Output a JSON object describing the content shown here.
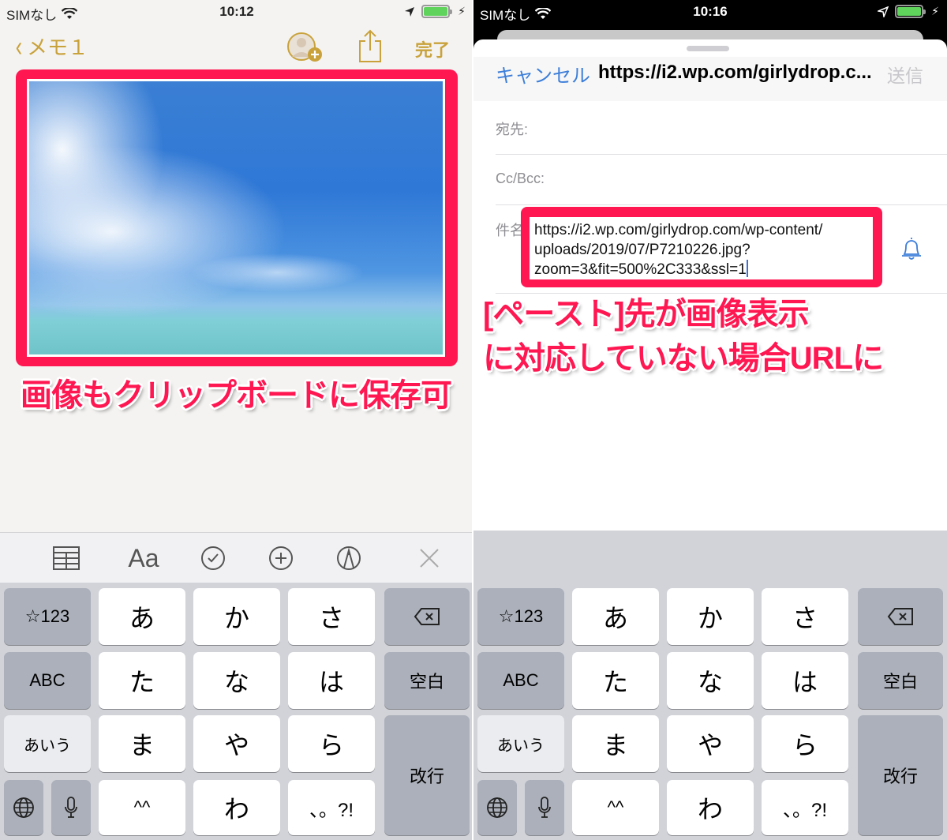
{
  "left": {
    "status_bar": {
      "carrier": "SIMなし",
      "time": "10:12",
      "battery_percent": 100,
      "charging": true
    },
    "nav": {
      "back_label": "メモ１",
      "done_label": "完了"
    },
    "caption": "画像もクリップボードに保存可",
    "format_bar": {
      "icons": [
        "table-icon",
        "text-style-icon",
        "checklist-icon",
        "add-icon",
        "markup-icon",
        "close-icon"
      ],
      "text_style_label": "Aa"
    },
    "keyboard": {
      "rows": [
        [
          "☆123",
          "あ",
          "か",
          "さ",
          "⌫"
        ],
        [
          "ABC",
          "た",
          "な",
          "は",
          "空白"
        ],
        [
          "あいう",
          "ま",
          "や",
          "ら",
          "改行"
        ],
        [
          "🌐",
          "🎤",
          "^^",
          "わ",
          "、。?!"
        ]
      ]
    }
  },
  "right": {
    "status_bar": {
      "carrier": "SIMなし",
      "time": "10:16",
      "battery_percent": 100,
      "charging": true
    },
    "mail": {
      "cancel_label": "キャンセル",
      "title": "https://i2.wp.com/girlydrop.c...",
      "send_label": "送信",
      "to_label": "宛先:",
      "cc_label": "Cc/Bcc:",
      "subject_label": "件名",
      "subject_value_lines": [
        "https://i2.wp.com/girlydrop.com/wp-content/",
        "uploads/2019/07/P7210226.jpg?",
        "zoom=3&fit=500%2C333&ssl=1"
      ]
    },
    "caption_lines": [
      "[ペースト]先が画像表示",
      "に対応していない場合URLに"
    ],
    "keyboard": {
      "rows": [
        [
          "☆123",
          "あ",
          "か",
          "さ",
          "⌫"
        ],
        [
          "ABC",
          "た",
          "な",
          "は",
          "空白"
        ],
        [
          "あいう",
          "ま",
          "や",
          "ら",
          "改行"
        ],
        [
          "🌐",
          "🎤",
          "^^",
          "わ",
          "、。?!"
        ]
      ]
    }
  },
  "colors": {
    "accent_notes": "#c9a23b",
    "highlight": "#ff1752",
    "mail_blue": "#3c7ed9"
  }
}
